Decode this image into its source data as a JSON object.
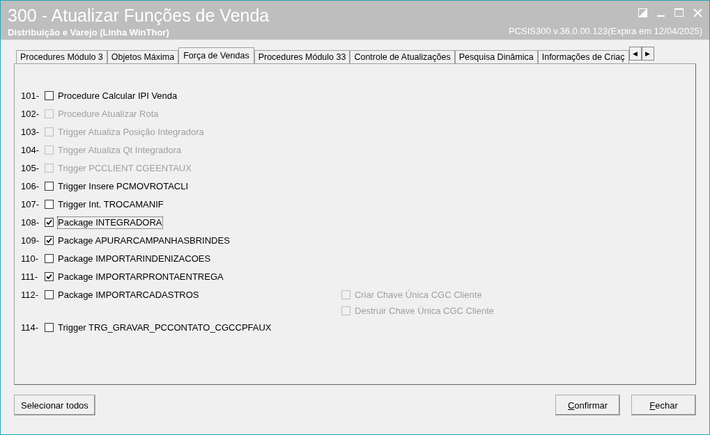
{
  "window": {
    "title": "300 - Atualizar Funções de Venda",
    "subtitle": "Distribuição e Varejo (Linha WinThor)",
    "version": "PCSIS300  v.36.0.00.123(Expira em 12/04/2025)"
  },
  "tabs": [
    {
      "label": "Procedures Módulo 3",
      "selected": false
    },
    {
      "label": "Objetos Máxima",
      "selected": false
    },
    {
      "label": "Força de Vendas",
      "selected": true
    },
    {
      "label": "Procedures Módulo 33",
      "selected": false
    },
    {
      "label": "Controle de Atualizações",
      "selected": false
    },
    {
      "label": "Pesquisa Dinâmica",
      "selected": false
    },
    {
      "label": "Informações de Criaç",
      "selected": false
    }
  ],
  "tab_scroll": [
    "◀",
    "▶"
  ],
  "options": [
    {
      "number": "101-",
      "label": "Procedure Calcular IPI Venda",
      "checked": false,
      "disabled": false,
      "focused": false
    },
    {
      "number": "102-",
      "label": "Procedure Atualizar Rota",
      "checked": false,
      "disabled": true,
      "focused": false
    },
    {
      "number": "103-",
      "label": "Trigger Atualiza Posição Integradora",
      "checked": false,
      "disabled": true,
      "focused": false
    },
    {
      "number": "104-",
      "label": "Trigger Atualiza Qt Integradora",
      "checked": false,
      "disabled": true,
      "focused": false
    },
    {
      "number": "105-",
      "label": "Trigger PCCLIENT CGEENTAUX",
      "checked": false,
      "disabled": true,
      "focused": false
    },
    {
      "number": "106-",
      "label": "Trigger Insere PCMOVROTACLI",
      "checked": false,
      "disabled": false,
      "focused": false
    },
    {
      "number": "107-",
      "label": "Trigger Int. TROCAMANIF",
      "checked": false,
      "disabled": false,
      "focused": false
    },
    {
      "number": "108-",
      "label": "Package INTEGRADORA",
      "checked": true,
      "disabled": false,
      "focused": true
    },
    {
      "number": "109-",
      "label": "Package APURARCAMPANHASBRINDES",
      "checked": true,
      "disabled": false,
      "focused": false
    },
    {
      "number": "110-",
      "label": "Package IMPORTARINDENIZACOES",
      "checked": false,
      "disabled": false,
      "focused": false
    },
    {
      "number": "111-",
      "label": "Package IMPORTARPRONTAENTREGA",
      "checked": true,
      "disabled": false,
      "focused": false
    },
    {
      "number": "112-",
      "label": "Package IMPORTARCADASTROS",
      "checked": false,
      "disabled": false,
      "focused": false,
      "sub_options": [
        {
          "label": "Criar Chave Única CGC Cliente",
          "checked": false,
          "disabled": true
        },
        {
          "label": "Destruir Chave Única CGC Cliente",
          "checked": false,
          "disabled": true
        }
      ]
    },
    {
      "number": "114-",
      "label": "Trigger TRG_GRAVAR_PCCONTATO_CGCCPFAUX",
      "checked": false,
      "disabled": false,
      "focused": false
    }
  ],
  "buttons": [
    {
      "label": "Selecionar todos",
      "mnemonic": false,
      "kind": "left"
    },
    {
      "label": "Confirmar",
      "mnemonic": true,
      "kind": "right"
    },
    {
      "label": "Fechar",
      "mnemonic": true,
      "kind": "right"
    }
  ]
}
